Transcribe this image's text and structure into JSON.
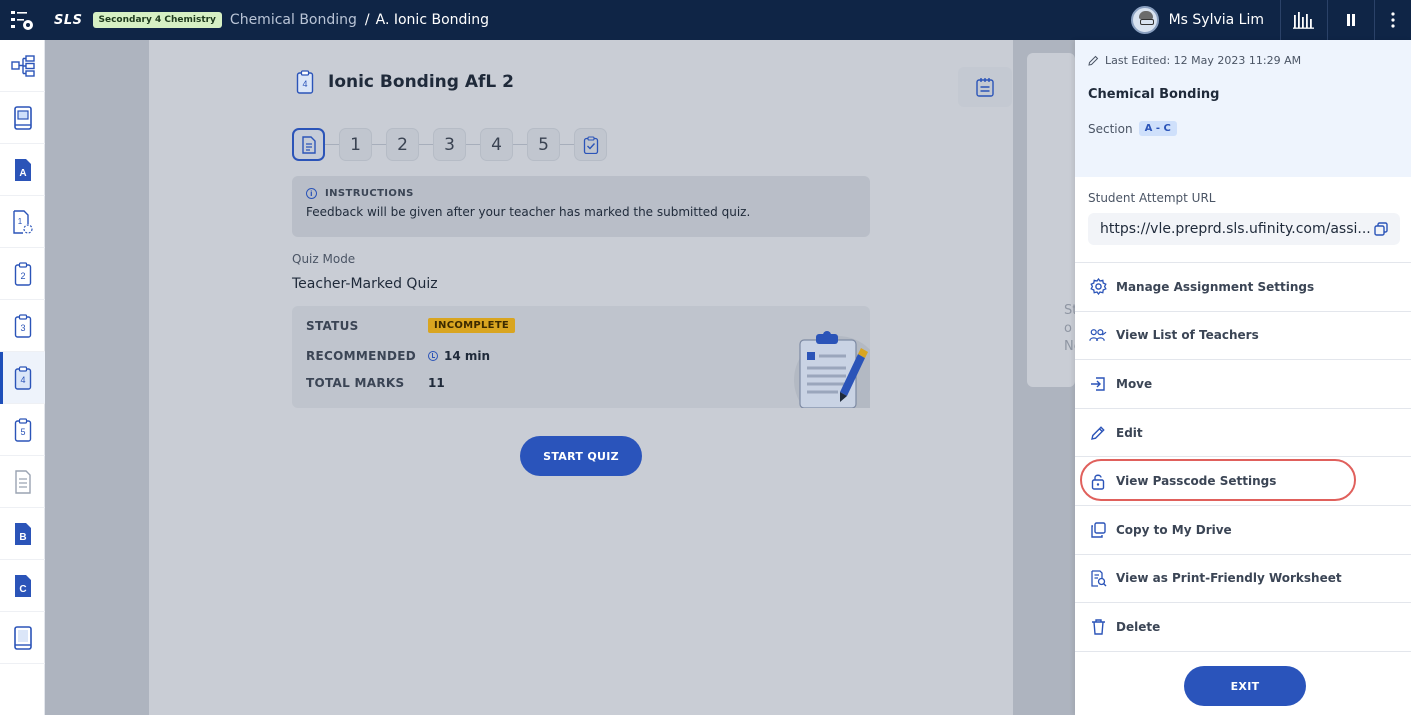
{
  "topbar": {
    "logo": "SLS",
    "level_badge": "Secondary 4 Chemistry",
    "breadcrumb_parent": "Chemical Bonding",
    "breadcrumb_separator": "/",
    "breadcrumb_current": "A. Ionic Bonding",
    "user_name": "Ms Sylvia Lim"
  },
  "rail": {
    "items": [
      {
        "icon": "structure-icon",
        "label": ""
      },
      {
        "icon": "book-icon",
        "label": ""
      },
      {
        "icon": "section-a-icon",
        "label": "A"
      },
      {
        "icon": "quiz-1-icon",
        "label": "1"
      },
      {
        "icon": "quiz-2-icon",
        "label": "2"
      },
      {
        "icon": "quiz-3-icon",
        "label": "3"
      },
      {
        "icon": "quiz-4-icon",
        "label": "4"
      },
      {
        "icon": "quiz-5-icon",
        "label": "5"
      },
      {
        "icon": "document-icon",
        "label": ""
      },
      {
        "icon": "section-b-icon",
        "label": "B"
      },
      {
        "icon": "section-c-icon",
        "label": "C"
      },
      {
        "icon": "book-end-icon",
        "label": ""
      }
    ],
    "active_index": 6
  },
  "quiz": {
    "badge_number": "4",
    "title": "Ionic Bonding AfL 2",
    "steps": [
      "1",
      "2",
      "3",
      "4",
      "5"
    ],
    "instructions_heading": "INSTRUCTIONS",
    "instructions_text": "Feedback will be given after your teacher has marked the submitted quiz.",
    "mode_label": "Quiz Mode",
    "mode_value": "Teacher-Marked Quiz",
    "status_label": "STATUS",
    "status_value": "INCOMPLETE",
    "recommended_label": "RECOMMENDED",
    "recommended_value": "14 min",
    "marks_label": "TOTAL MARKS",
    "marks_value": "11",
    "start_label": "START QUIZ"
  },
  "partial_text": {
    "line1": "St",
    "line2": "o",
    "line3": "Ne"
  },
  "panel": {
    "last_edited": "Last Edited: 12 May 2023 11:29 AM",
    "title": "Chemical Bonding",
    "section_label": "Section",
    "section_value": "A - C",
    "url_label": "Student Attempt URL",
    "url_value": "https://vle.preprd.sls.ufinity.com/assi...",
    "menu": [
      {
        "label": "Manage Assignment Settings",
        "icon": "gear-icon"
      },
      {
        "label": "View List of Teachers",
        "icon": "teachers-icon"
      },
      {
        "label": "Move",
        "icon": "move-icon"
      },
      {
        "label": "Edit",
        "icon": "pencil-icon"
      },
      {
        "label": "View Passcode Settings",
        "icon": "lock-icon"
      },
      {
        "label": "Copy to My Drive",
        "icon": "copy-icon"
      },
      {
        "label": "View as Print-Friendly Worksheet",
        "icon": "worksheet-icon"
      },
      {
        "label": "Delete",
        "icon": "trash-icon"
      }
    ],
    "exit_label": "EXIT"
  },
  "colors": {
    "topbar": "#0f2546",
    "accent": "#2a54bb",
    "status_incomplete": "#d9a520",
    "highlight_ring": "#e0605c"
  }
}
